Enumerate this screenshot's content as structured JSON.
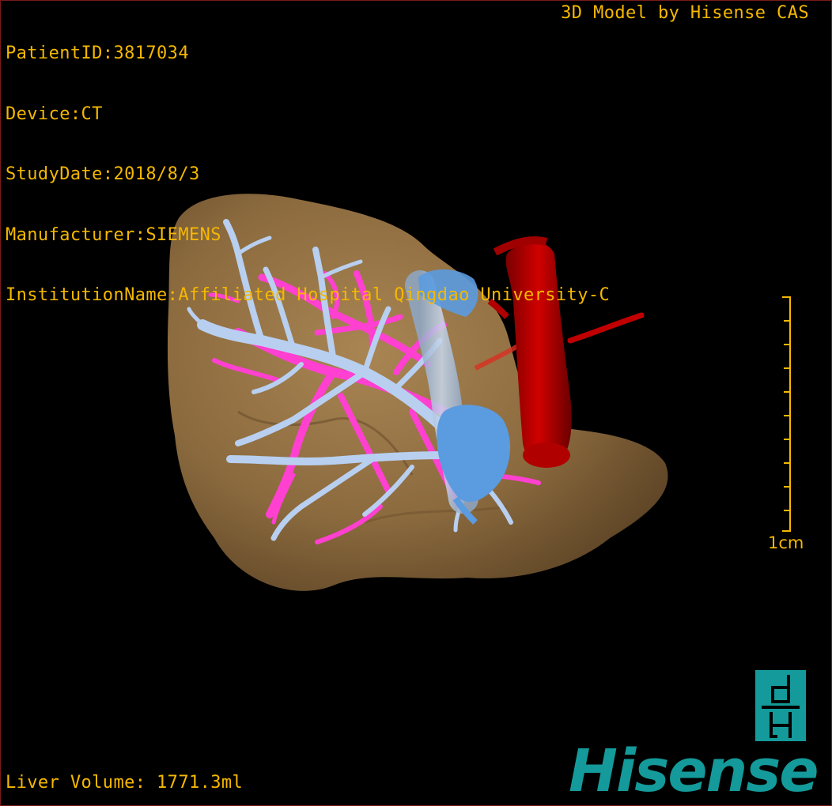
{
  "header": {
    "patient_id": "PatientID:3817034",
    "device": "Device:CT",
    "study_date": "StudyDate:2018/8/3",
    "manufacturer": "Manufacturer:SIEMENS",
    "institution": "InstitutionName:Affiliated Hospital Qingdao University-C",
    "model_credit": "3D Model by Hisense CAS"
  },
  "footer": {
    "liver_volume": "Liver Volume: 1771.3ml"
  },
  "scale": {
    "label": "1cm",
    "tick_count": 11
  },
  "logo": {
    "word": "Hisense",
    "badge_icon": "hisense-dh-icon"
  },
  "colors": {
    "overlay_text": "#f5b800",
    "liver": "#8b6a3e",
    "portal_vein": "#b8cff0",
    "hepatic_vein_ivc": "#5b9be0",
    "hepatic_artery": "#ff40d0",
    "aorta": "#c00000",
    "brand": "#149a9a"
  },
  "viewer": {
    "structures": [
      "liver",
      "portal-vein",
      "hepatic-veins",
      "hepatic-artery",
      "aorta"
    ]
  }
}
